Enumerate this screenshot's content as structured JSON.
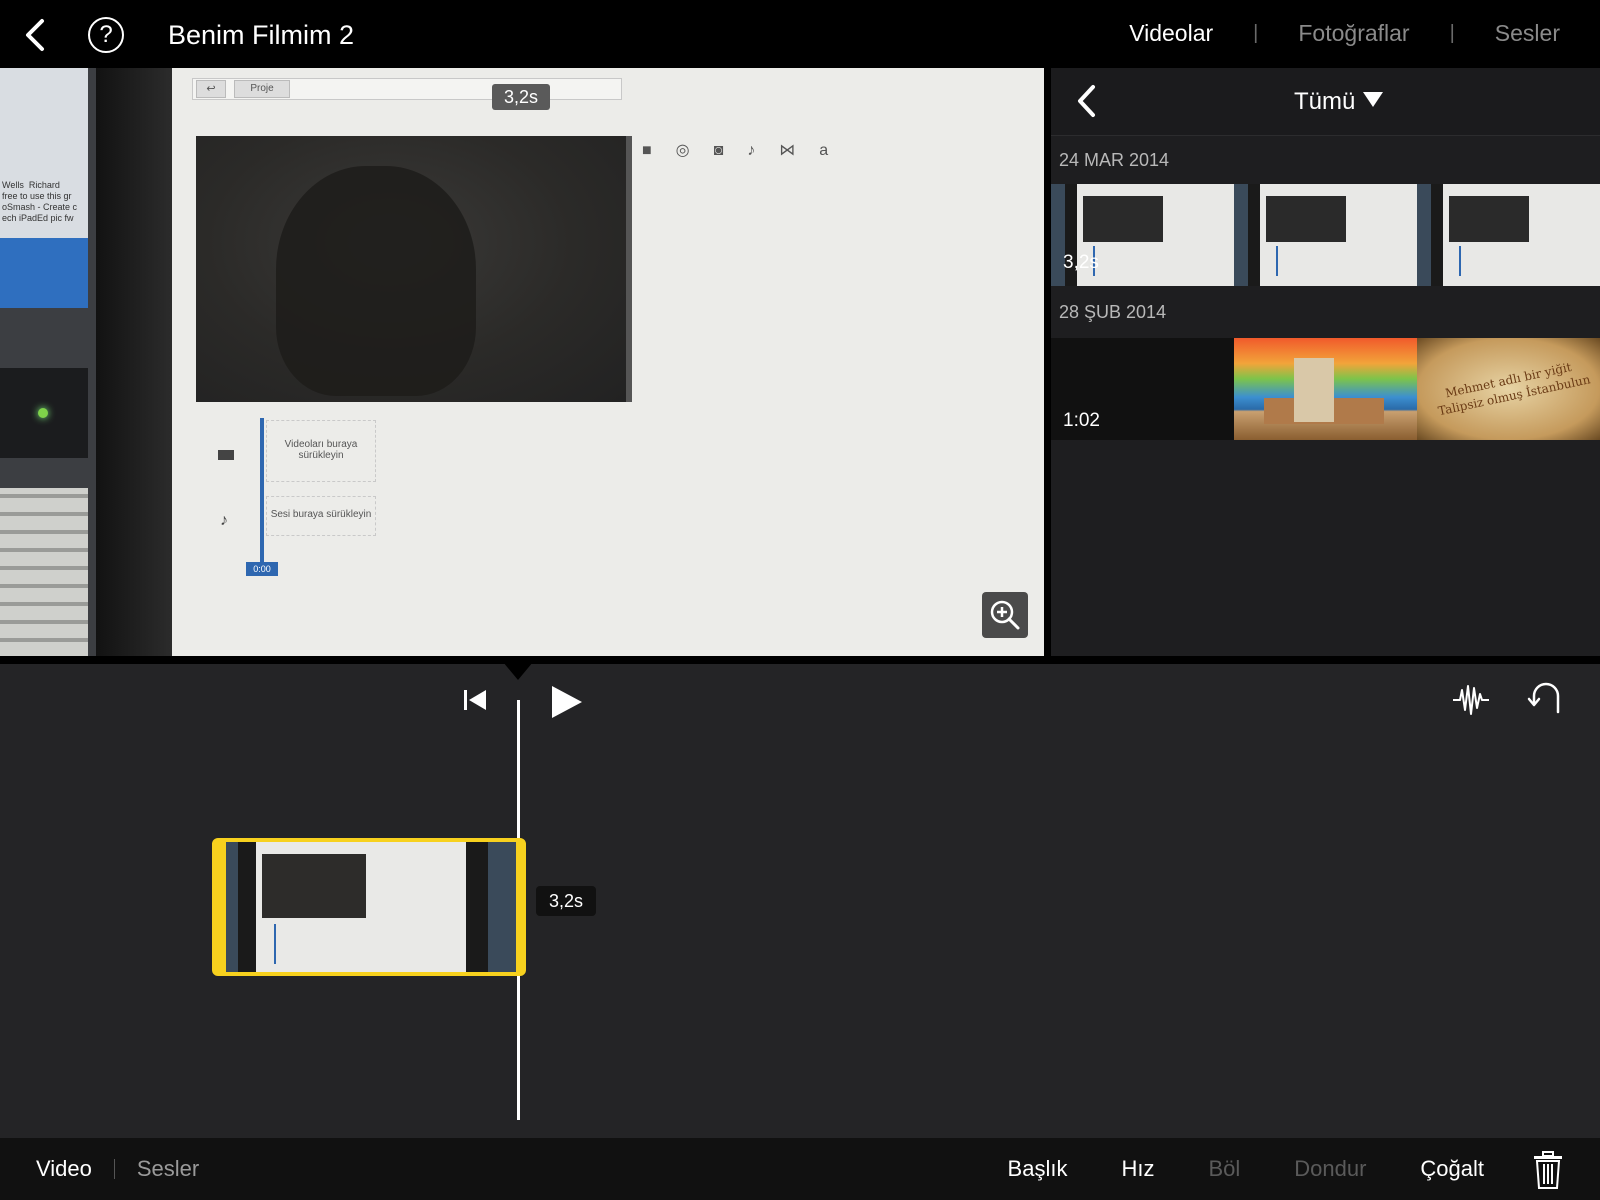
{
  "header": {
    "project_title": "Benim Filmim 2",
    "help_label": "?",
    "tabs": [
      {
        "label": "Videolar",
        "active": true
      },
      {
        "label": "Fotoğraflar",
        "active": false
      },
      {
        "label": "Sesler",
        "active": false
      }
    ]
  },
  "viewer": {
    "clip_duration": "3,2s",
    "screen": {
      "proje_label": "Proje",
      "drop_video": "Videoları buraya sürükleyin",
      "drop_audio": "Sesi buraya sürükleyin",
      "timecode": "0:00",
      "background_text": "Wells  Richard\nfree to use this gr\noSmash - Create c\nech iPadEd pic fw"
    }
  },
  "browser": {
    "filter_label": "Tümü",
    "groups": [
      {
        "date": "24 MAR 2014",
        "duration": "3,2s"
      },
      {
        "date": "28 ŞUB 2014",
        "duration": "1:02"
      }
    ],
    "scroll_text": "Mehmet adlı bir yiğit\nTalipsiz olmuş İstanbulun"
  },
  "timeline": {
    "clip_duration": "3,2s"
  },
  "bottom": {
    "left": [
      {
        "label": "Video",
        "active": true
      },
      {
        "label": "Sesler",
        "active": false
      }
    ],
    "actions": [
      {
        "label": "Başlık",
        "enabled": true
      },
      {
        "label": "Hız",
        "enabled": true
      },
      {
        "label": "Böl",
        "enabled": false
      },
      {
        "label": "Dondur",
        "enabled": false
      },
      {
        "label": "Çoğalt",
        "enabled": true
      }
    ]
  },
  "colors": {
    "clip_selection": "#f7d11e",
    "used_marker": "#f5a623"
  }
}
